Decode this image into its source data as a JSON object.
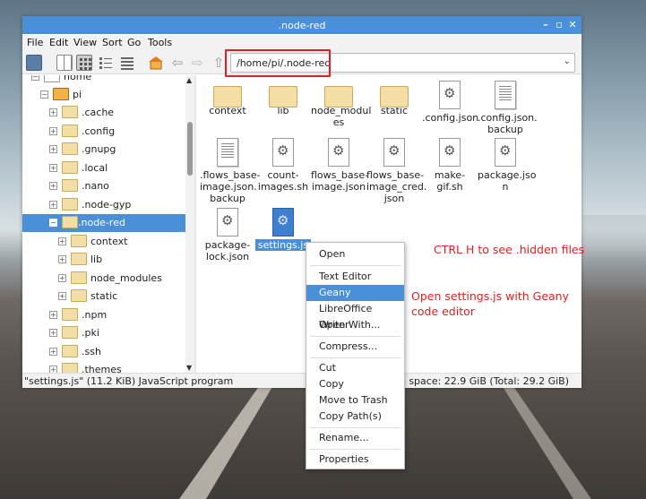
{
  "window": {
    "title": ".node-red"
  },
  "menu": [
    "File",
    "Edit",
    "View",
    "Sort",
    "Go",
    "Tools"
  ],
  "address": {
    "path": "/home/pi/.node-red"
  },
  "sidebar": {
    "items": [
      {
        "label": "home",
        "expanded": true
      },
      {
        "label": "pi",
        "expanded": true
      },
      {
        "label": ".cache"
      },
      {
        "label": ".config"
      },
      {
        "label": ".gnupg"
      },
      {
        "label": ".local"
      },
      {
        "label": ".nano"
      },
      {
        "label": ".node-gyp"
      },
      {
        "label": ".node-red",
        "selected": true,
        "expanded": true
      },
      {
        "label": "context"
      },
      {
        "label": "lib"
      },
      {
        "label": "node_modules"
      },
      {
        "label": "static"
      },
      {
        "label": ".npm"
      },
      {
        "label": ".pki"
      },
      {
        "label": ".ssh"
      },
      {
        "label": ".themes"
      }
    ]
  },
  "files": [
    {
      "name": "context",
      "kind": "folder"
    },
    {
      "name": "lib",
      "kind": "folder"
    },
    {
      "name": "node_modul\nes",
      "kind": "folder"
    },
    {
      "name": "static",
      "kind": "folder"
    },
    {
      "name": ".config.json",
      "kind": "script"
    },
    {
      "name": ".config.json.\nbackup",
      "kind": "doc"
    },
    {
      "name": ".flows_base-\nimage.json.\nbackup",
      "kind": "doc"
    },
    {
      "name": "count-\nimages.sh",
      "kind": "script"
    },
    {
      "name": "flows_base-\nimage.json",
      "kind": "script"
    },
    {
      "name": "flows_base-\nimage_cred.\njson",
      "kind": "script"
    },
    {
      "name": "make-gif.sh",
      "kind": "script"
    },
    {
      "name": "package.jso\nn",
      "kind": "script"
    },
    {
      "name": "package-\nlock.json",
      "kind": "script"
    },
    {
      "name": "settings.js",
      "kind": "script",
      "selected": true
    }
  ],
  "status": {
    "left": "\"settings.js\" (11.2 KiB) JavaScript program",
    "right": "Free space: 22.9 GiB (Total: 29.2 GiB)"
  },
  "context_menu": {
    "items": [
      "Open",
      "Text Editor",
      "Geany",
      "LibreOffice Writer",
      "Open With...",
      "Compress...",
      "Cut",
      "Copy",
      "Move to Trash",
      "Copy Path(s)",
      "Rename...",
      "Properties"
    ],
    "highlighted": "Geany"
  },
  "annotations": {
    "hidden_files": "CTRL H to see .hidden files",
    "geany_line1": "Open settings.js with Geany",
    "geany_line2": "code editor"
  },
  "colors": {
    "accent": "#4a90d9",
    "annotation": "#e02020"
  }
}
